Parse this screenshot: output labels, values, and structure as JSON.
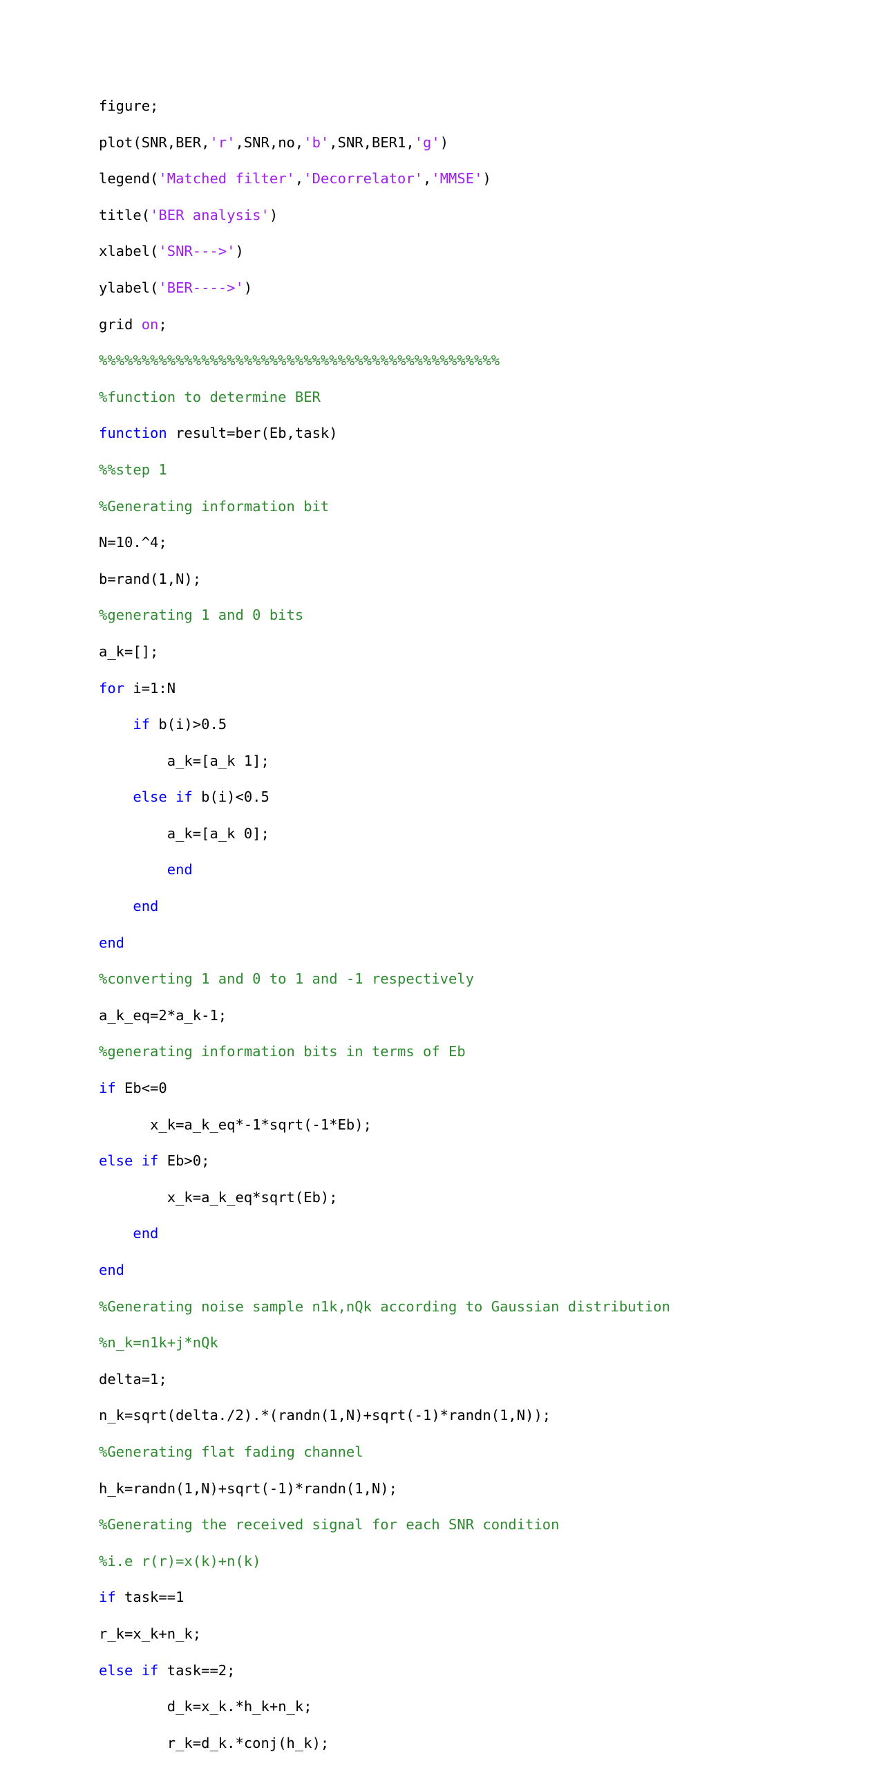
{
  "document": {
    "kind": "code-listing",
    "language": "MATLAB",
    "background_color": "#ffffff",
    "colors": {
      "plain": "#000000",
      "comment": "#2e8b30",
      "keyword": "#0000ff",
      "string": "#a020f0"
    }
  },
  "code": {
    "lines": [
      [
        {
          "t": "plain",
          "s": "figure;"
        }
      ],
      [
        {
          "t": "plain",
          "s": "plot(SNR,BER,"
        },
        {
          "t": "string",
          "s": "'r'"
        },
        {
          "t": "plain",
          "s": ",SNR,no,"
        },
        {
          "t": "string",
          "s": "'b'"
        },
        {
          "t": "plain",
          "s": ",SNR,BER1,"
        },
        {
          "t": "string",
          "s": "'g'"
        },
        {
          "t": "plain",
          "s": ")"
        }
      ],
      [
        {
          "t": "plain",
          "s": "legend("
        },
        {
          "t": "string",
          "s": "'Matched filter'"
        },
        {
          "t": "plain",
          "s": ","
        },
        {
          "t": "string",
          "s": "'Decorrelator'"
        },
        {
          "t": "plain",
          "s": ","
        },
        {
          "t": "string",
          "s": "'MMSE'"
        },
        {
          "t": "plain",
          "s": ")"
        }
      ],
      [
        {
          "t": "plain",
          "s": "title("
        },
        {
          "t": "string",
          "s": "'BER analysis'"
        },
        {
          "t": "plain",
          "s": ")"
        }
      ],
      [
        {
          "t": "plain",
          "s": "xlabel("
        },
        {
          "t": "string",
          "s": "'SNR--->'"
        },
        {
          "t": "plain",
          "s": ")"
        }
      ],
      [
        {
          "t": "plain",
          "s": "ylabel("
        },
        {
          "t": "string",
          "s": "'BER---->'"
        },
        {
          "t": "plain",
          "s": ")"
        }
      ],
      [
        {
          "t": "plain",
          "s": "grid "
        },
        {
          "t": "string",
          "s": "on"
        },
        {
          "t": "plain",
          "s": ";"
        }
      ],
      [
        {
          "t": "comment",
          "s": "%%%%%%%%%%%%%%%%%%%%%%%%%%%%%%%%%%%%%%%%%%%%%%%"
        }
      ],
      [
        {
          "t": "comment",
          "s": "%function to determine BER"
        }
      ],
      [
        {
          "t": "keyword",
          "s": "function"
        },
        {
          "t": "plain",
          "s": " result=ber(Eb,task)"
        }
      ],
      [
        {
          "t": "comment",
          "s": "%%step 1"
        }
      ],
      [
        {
          "t": "comment",
          "s": "%Generating information bit"
        }
      ],
      [
        {
          "t": "plain",
          "s": "N=10.^4;"
        }
      ],
      [
        {
          "t": "plain",
          "s": "b=rand(1,N);"
        }
      ],
      [
        {
          "t": "comment",
          "s": "%generating 1 and 0 bits"
        }
      ],
      [
        {
          "t": "plain",
          "s": "a_k=[];"
        }
      ],
      [
        {
          "t": "keyword",
          "s": "for"
        },
        {
          "t": "plain",
          "s": " i=1:N"
        }
      ],
      [
        {
          "t": "plain",
          "s": "    "
        },
        {
          "t": "keyword",
          "s": "if"
        },
        {
          "t": "plain",
          "s": " b(i)>0.5"
        }
      ],
      [
        {
          "t": "plain",
          "s": "        a_k=[a_k 1];"
        }
      ],
      [
        {
          "t": "plain",
          "s": "    "
        },
        {
          "t": "keyword",
          "s": "else if"
        },
        {
          "t": "plain",
          "s": " b(i)<0.5"
        }
      ],
      [
        {
          "t": "plain",
          "s": "        a_k=[a_k 0];"
        }
      ],
      [
        {
          "t": "plain",
          "s": "        "
        },
        {
          "t": "keyword",
          "s": "end"
        }
      ],
      [
        {
          "t": "plain",
          "s": "    "
        },
        {
          "t": "keyword",
          "s": "end"
        }
      ],
      [
        {
          "t": "keyword",
          "s": "end"
        }
      ],
      [
        {
          "t": "comment",
          "s": "%converting 1 and 0 to 1 and -1 respectively"
        }
      ],
      [
        {
          "t": "plain",
          "s": "a_k_eq=2*a_k-1;"
        }
      ],
      [
        {
          "t": "comment",
          "s": "%generating information bits in terms of Eb"
        }
      ],
      [
        {
          "t": "keyword",
          "s": "if"
        },
        {
          "t": "plain",
          "s": " Eb<=0"
        }
      ],
      [
        {
          "t": "plain",
          "s": "      x_k=a_k_eq*-1*sqrt(-1*Eb);"
        }
      ],
      [
        {
          "t": "keyword",
          "s": "else if"
        },
        {
          "t": "plain",
          "s": " Eb>0;"
        }
      ],
      [
        {
          "t": "plain",
          "s": "        x_k=a_k_eq*sqrt(Eb);"
        }
      ],
      [
        {
          "t": "plain",
          "s": "    "
        },
        {
          "t": "keyword",
          "s": "end"
        }
      ],
      [
        {
          "t": "keyword",
          "s": "end"
        }
      ],
      [
        {
          "t": "comment",
          "s": "%Generating noise sample n1k,nQk according to Gaussian distribution"
        }
      ],
      [
        {
          "t": "comment",
          "s": "%n_k=n1k+j*nQk"
        }
      ],
      [
        {
          "t": "plain",
          "s": "delta=1;"
        }
      ],
      [
        {
          "t": "plain",
          "s": "n_k=sqrt(delta./2).*(randn(1,N)+sqrt(-1)*randn(1,N));"
        }
      ],
      [
        {
          "t": "comment",
          "s": "%Generating flat fading channel"
        }
      ],
      [
        {
          "t": "plain",
          "s": "h_k=randn(1,N)+sqrt(-1)*randn(1,N);"
        }
      ],
      [
        {
          "t": "comment",
          "s": "%Generating the received signal for each SNR condition"
        }
      ],
      [
        {
          "t": "comment",
          "s": "%i.e r(r)=x(k)+n(k)"
        }
      ],
      [
        {
          "t": "keyword",
          "s": "if"
        },
        {
          "t": "plain",
          "s": " task==1"
        }
      ],
      [
        {
          "t": "plain",
          "s": "r_k=x_k+n_k;"
        }
      ],
      [
        {
          "t": "keyword",
          "s": "else if"
        },
        {
          "t": "plain",
          "s": " task==2;"
        }
      ],
      [
        {
          "t": "plain",
          "s": "        d_k=x_k.*h_k+n_k;"
        }
      ],
      [
        {
          "t": "plain",
          "s": "        r_k=d_k.*conj(h_k);"
        }
      ]
    ]
  }
}
